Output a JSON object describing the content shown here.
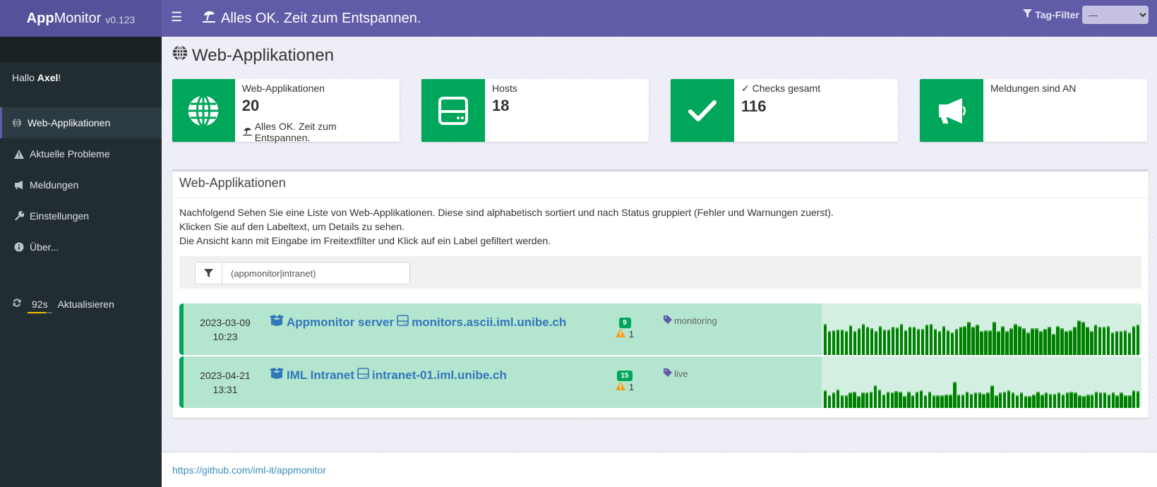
{
  "header": {
    "brand_bold": "App",
    "brand_rest": "Monitor",
    "version": "v0.123",
    "status_text": "Alles OK. Zeit zum Entspannen.",
    "tag_filter_label": "Tag-Filter",
    "tag_filter_value": "---"
  },
  "sidebar": {
    "greeting_prefix": "Hallo ",
    "user": "Axel",
    "greeting_suffix": "!",
    "items": [
      {
        "label": "Web-Applikationen",
        "icon": "globe-icon",
        "active": true
      },
      {
        "label": "Aktuelle Probleme",
        "icon": "warning-icon",
        "active": false
      },
      {
        "label": "Meldungen",
        "icon": "bullhorn-icon",
        "active": false
      },
      {
        "label": "Einstellungen",
        "icon": "wrench-icon",
        "active": false
      },
      {
        "label": "Über...",
        "icon": "info-icon",
        "active": false
      }
    ],
    "refresh_countdown": "92s",
    "refresh_label": "Aktualisieren",
    "refresh_progress": 0.75
  },
  "page": {
    "title": "Web-Applikationen"
  },
  "stats": [
    {
      "label": "Web-Applikationen",
      "value": "20",
      "sub": "Alles OK. Zeit zum Entspannen.",
      "icon": "globe-icon"
    },
    {
      "label": "Hosts",
      "value": "18",
      "sub": "",
      "icon": "server-icon"
    },
    {
      "label": "Checks gesamt",
      "value": "116",
      "sub": "",
      "icon": "check-icon"
    },
    {
      "label": "Meldungen sind AN",
      "value": "",
      "sub": "",
      "icon": "bullhorn-icon"
    }
  ],
  "card": {
    "title": "Web-Applikationen",
    "desc": [
      "Nachfolgend Sehen Sie eine Liste von Web-Applikationen. Diese sind alphabetisch sortiert und nach Status gruppiert (Fehler und Warnungen zuerst).",
      "Klicken Sie auf den Labeltext, um Details zu sehen.",
      "Die Ansicht kann mit Eingabe im Freitextfilter und Klick auf ein Label gefiltert werden."
    ],
    "filter_value": "(appmonitor|intranet)"
  },
  "apps": [
    {
      "date": "2023-03-09",
      "time": "10:23",
      "name": "Appmonitor server",
      "host": "monitors.ascii.iml.unibe.ch",
      "ok_count": "9",
      "warn_count": "1",
      "tag": "monitoring",
      "status_color": "#00a65a",
      "sparkline": [
        74,
        56,
        58,
        60,
        60,
        57,
        70,
        56,
        64,
        73,
        67,
        63,
        56,
        69,
        60,
        60,
        67,
        65,
        74,
        58,
        66,
        66,
        62,
        62,
        72,
        74,
        62,
        56,
        69,
        58,
        54,
        62,
        67,
        68,
        78,
        66,
        72,
        56,
        58,
        58,
        78,
        56,
        68,
        56,
        64,
        74,
        68,
        64,
        54,
        64,
        64,
        56,
        62,
        66,
        50,
        68,
        64,
        56,
        58,
        66,
        82,
        79,
        66,
        56,
        72,
        66,
        66,
        68,
        54,
        56,
        56,
        58,
        54,
        68,
        72
      ],
      "sparkline_max": 100
    },
    {
      "date": "2023-04-21",
      "time": "13:31",
      "name": "IML Intranet",
      "host": "intranet-01.iml.unibe.ch",
      "ok_count": "15",
      "warn_count": "1",
      "tag": "live",
      "status_color": "#00a65a",
      "sparkline": [
        42,
        30,
        36,
        44,
        30,
        30,
        36,
        38,
        28,
        36,
        36,
        38,
        54,
        44,
        32,
        38,
        36,
        40,
        38,
        28,
        38,
        30,
        38,
        42,
        30,
        38,
        30,
        30,
        30,
        32,
        32,
        62,
        32,
        32,
        38,
        34,
        36,
        36,
        34,
        36,
        54,
        30,
        36,
        38,
        42,
        36,
        30,
        36,
        28,
        28,
        32,
        38,
        32,
        36,
        34,
        34,
        36,
        32,
        36,
        38,
        36,
        30,
        28,
        32,
        32,
        38,
        36,
        36,
        32,
        36,
        30,
        36,
        30,
        30,
        42,
        40
      ],
      "sparkline_max": 100
    }
  ],
  "footer": {
    "link": "https://github.com/iml-it/appmonitor"
  }
}
